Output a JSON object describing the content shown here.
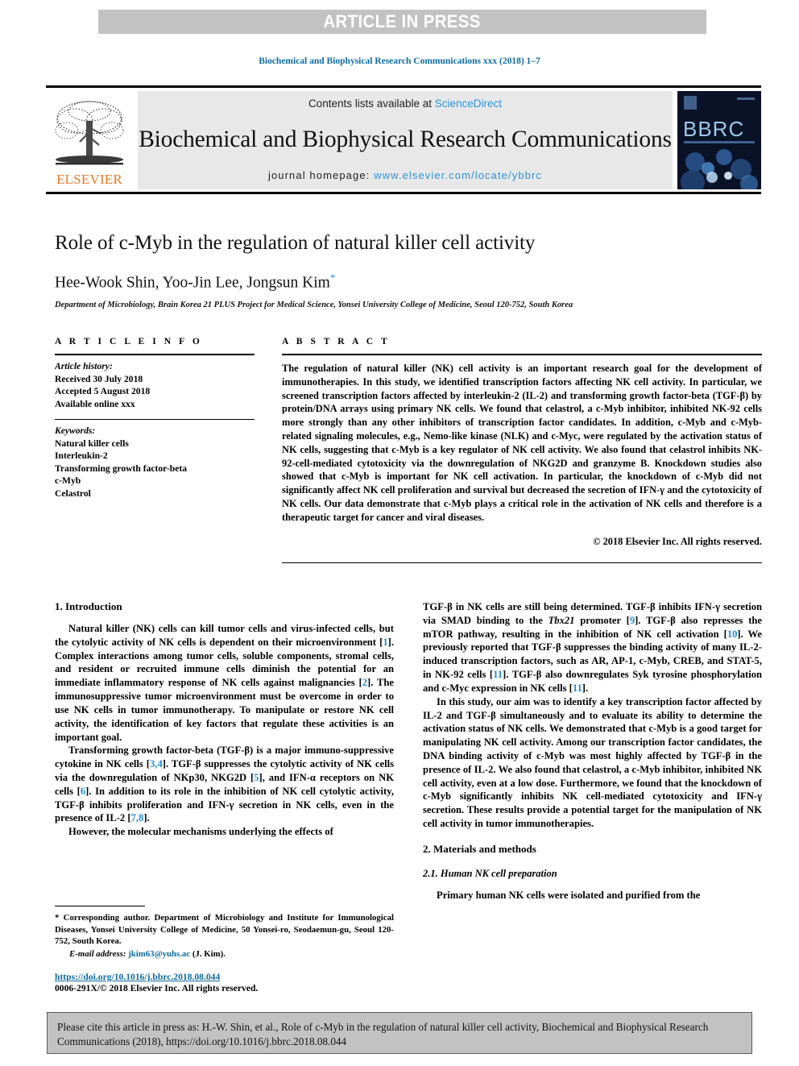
{
  "banner": {
    "text": "ARTICLE IN PRESS"
  },
  "running_head": "Biochemical and Biophysical Research Communications xxx (2018) 1–7",
  "masthead": {
    "contents_prefix": "Contents lists available at ",
    "sciencedirect": "ScienceDirect",
    "journal_title": "Biochemical and Biophysical Research Communications",
    "homepage_prefix": "journal homepage: ",
    "homepage_url": "www.elsevier.com/locate/ybbrc",
    "publisher": "ELSEVIER",
    "cover_word": "BBRC"
  },
  "title": "Role of c-Myb in the regulation of natural killer cell activity",
  "authors": "Hee-Wook Shin, Yoo-Jin Lee, Jongsun Kim",
  "author_star": "*",
  "affiliation": "Department of Microbiology, Brain Korea 21 PLUS Project for Medical Science, Yonsei University College of Medicine, Seoul 120-752, South Korea",
  "article_info": {
    "heading": "A R T I C L E  I N F O",
    "history_label": "Article history:",
    "history": [
      "Received 30 July 2018",
      "Accepted 5 August 2018",
      "Available online xxx"
    ],
    "keywords_label": "Keywords:",
    "keywords": [
      "Natural killer cells",
      "Interleukin-2",
      "Transforming growth factor-beta",
      "c-Myb",
      "Celastrol"
    ]
  },
  "abstract": {
    "heading": "A B S T R A C T",
    "text": "The regulation of natural killer (NK) cell activity is an important research goal for the development of immunotherapies. In this study, we identified transcription factors affecting NK cell activity. In particular, we screened transcription factors affected by interleukin-2 (IL-2) and transforming growth factor-beta (TGF-β) by protein/DNA arrays using primary NK cells. We found that celastrol, a c-Myb inhibitor, inhibited NK-92 cells more strongly than any other inhibitors of transcription factor candidates. In addition, c-Myb and c-Myb-related signaling molecules, e.g., Nemo-like kinase (NLK) and c-Myc, were regulated by the activation status of NK cells, suggesting that c-Myb is a key regulator of NK cell activity. We also found that celastrol inhibits NK-92-cell-mediated cytotoxicity via the downregulation of NKG2D and granzyme B. Knockdown studies also showed that c-Myb is important for NK cell activation. In particular, the knockdown of c-Myb did not significantly affect NK cell proliferation and survival but decreased the secretion of IFN-γ and the cytotoxicity of NK cells. Our data demonstrate that c-Myb plays a critical role in the activation of NK cells and therefore is a therapeutic target for cancer and viral diseases.",
    "copyright": "© 2018 Elsevier Inc. All rights reserved."
  },
  "sections": {
    "intro_heading": "1. Introduction",
    "methods_heading": "2. Materials and methods",
    "methods_sub_heading": "2.1. Human NK cell preparation"
  },
  "paragraphs": {
    "p1": "Natural killer (NK) cells can kill tumor cells and virus-infected cells, but the cytolytic activity of NK cells is dependent on their microenvironment [1]. Complex interactions among tumor cells, soluble components, stromal cells, and resident or recruited immune cells diminish the potential for an immediate inflammatory response of NK cells against malignancies [2]. The immunosuppressive tumor microenvironment must be overcome in order to use NK cells in tumor immunotherapy. To manipulate or restore NK cell activity, the identification of key factors that regulate these activities is an important goal.",
    "p2": "Transforming growth factor-beta (TGF-β) is a major immunosuppressive cytokine in NK cells [3,4]. TGF-β suppresses the cytolytic activity of NK cells via the downregulation of NKp30, NKG2D [5], and IFN-α receptors on NK cells [6]. In addition to its role in the inhibition of NK cell cytolytic activity, TGF-β inhibits proliferation and IFN-γ secretion in NK cells, even in the presence of IL-2 [7,8].",
    "p3_start": "However, the molecular mechanisms underlying the effects of",
    "p3_cont": "TGF-β in NK cells are still being determined. TGF-β inhibits IFN-γ secretion via SMAD binding to the Tbx21 promoter [9]. TGF-β also represses the mTOR pathway, resulting in the inhibition of NK cell activation [10]. We previously reported that TGF-β suppresses the binding activity of many IL-2-induced transcription factors, such as AR, AP-1, c-Myb, CREB, and STAT-5, in NK-92 cells [11]. TGF-β also downregulates Syk tyrosine phosphorylation and c-Myc expression in NK cells [11].",
    "p4": "In this study, our aim was to identify a key transcription factor affected by IL-2 and TGF-β simultaneously and to evaluate its ability to determine the activation status of NK cells. We demonstrated that c-Myb is a good target for manipulating NK cell activity. Among our transcription factor candidates, the DNA binding activity of c-Myb was most highly affected by TGF-β in the presence of IL-2. We also found that celastrol, a c-Myb inhibitor, inhibited NK cell activity, even at a low dose. Furthermore, we found that the knockdown of c-Myb significantly inhibits NK cell-mediated cytotoxicity and IFN-γ secretion. These results provide a potential target for the manipulation of NK cell activity in tumor immunotherapies.",
    "p5": "Primary human NK cells were isolated and purified from the"
  },
  "footnote": {
    "text": "* Corresponding author. Department of Microbiology and Institute for Immunological Diseases, Yonsei University College of Medicine, 50 Yonsei-ro, Seodaemun-gu, Seoul 120-752, South Korea.",
    "email_label": "E-mail address:",
    "email": "jkim63@yuhs.ac",
    "email_owner": "(J. Kim)."
  },
  "doi": {
    "url": "https://doi.org/10.1016/j.bbrc.2018.08.044",
    "issn": "0006-291X/© 2018 Elsevier Inc. All rights reserved."
  },
  "citation_box": {
    "text": "Please cite this article in press as: H.-W. Shin, et al., Role of c-Myb in the regulation of natural killer cell activity, Biochemical and Biophysical Research Communications (2018), https://doi.org/10.1016/j.bbrc.2018.08.044"
  },
  "colors": {
    "link_blue": "#2a94d6",
    "ref_blue": "#1f8dd6",
    "header_blue": "#0b6aa2",
    "elsevier_orange": "#e87722",
    "banner_gray": "#c2c2c2"
  }
}
